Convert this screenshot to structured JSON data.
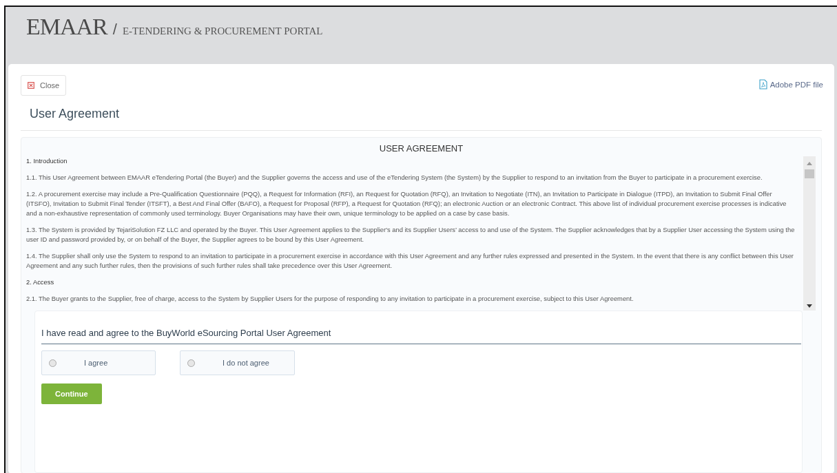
{
  "header": {
    "logo": "EMAAR",
    "separator": "/",
    "portal_title": "E-TENDERING & PROCUREMENT PORTAL"
  },
  "toolbar": {
    "close_button": "Close",
    "pdf_link": "Adobe PDF file"
  },
  "page_title": "User Agreement",
  "agreement": {
    "heading": "USER AGREEMENT",
    "paragraphs": [
      {
        "kind": "section",
        "text": "1. Introduction"
      },
      {
        "kind": "clause",
        "text": "1.1. This User Agreement between EMAAR eTendering Portal (the Buyer) and the Supplier governs the access and use of the eTendering System (the System) by the Supplier to respond to an invitation from the Buyer to participate in a procurement exercise."
      },
      {
        "kind": "clause",
        "text": "1.2. A procurement exercise may include a Pre-Qualification Questionnaire (PQQ), a Request for Information (RFI), an Request for Quotation (RFQ), an Invitation to Negotiate (ITN), an Invitation to Participate in Dialogue (ITPD), an Invitation to Submit Final Offer (ITSFO), Invitation to Submit Final Tender (ITSFT), a Best And Final Offer (BAFO), a Request for Proposal (RFP), a Request for Quotation (RFQ); an electronic Auction or an electronic Contract. This above list of individual procurement exercise processes is indicative and a non-exhaustive representation of commonly used terminology. Buyer Organisations may have their own, unique terminology to be applied on a case by case basis."
      },
      {
        "kind": "clause",
        "text": "1.3. The System is provided by TejariSolution FZ LLC and operated by the Buyer. This User Agreement applies to the Supplier's and its Supplier Users’ access to and use of the System. The Supplier acknowledges that by a Supplier User accessing the System using the user ID and password provided by, or on behalf of the Buyer, the Supplier agrees to be bound by this User Agreement."
      },
      {
        "kind": "clause",
        "text": "1.4. The Supplier shall only use the System to respond to an invitation to participate in a procurement exercise in accordance with this User Agreement and any further rules expressed and presented in the System. In the event that there is any conflict between this User Agreement and any such further rules, then the provisions of such further rules shall take precedence over this User Agreement."
      },
      {
        "kind": "section",
        "text": "2. Access"
      },
      {
        "kind": "clause",
        "text": "2.1. The Buyer grants to the Supplier, free of charge, access to the System by Supplier Users for the purpose of responding to any invitation to participate in a procurement exercise, subject to this User Agreement."
      }
    ]
  },
  "consent": {
    "question": "I have read and agree to the BuyWorld eSourcing Portal User Agreement",
    "options": [
      {
        "label": "I agree",
        "selected": false
      },
      {
        "label": "I do not agree",
        "selected": false
      }
    ],
    "continue_button": "Continue"
  }
}
